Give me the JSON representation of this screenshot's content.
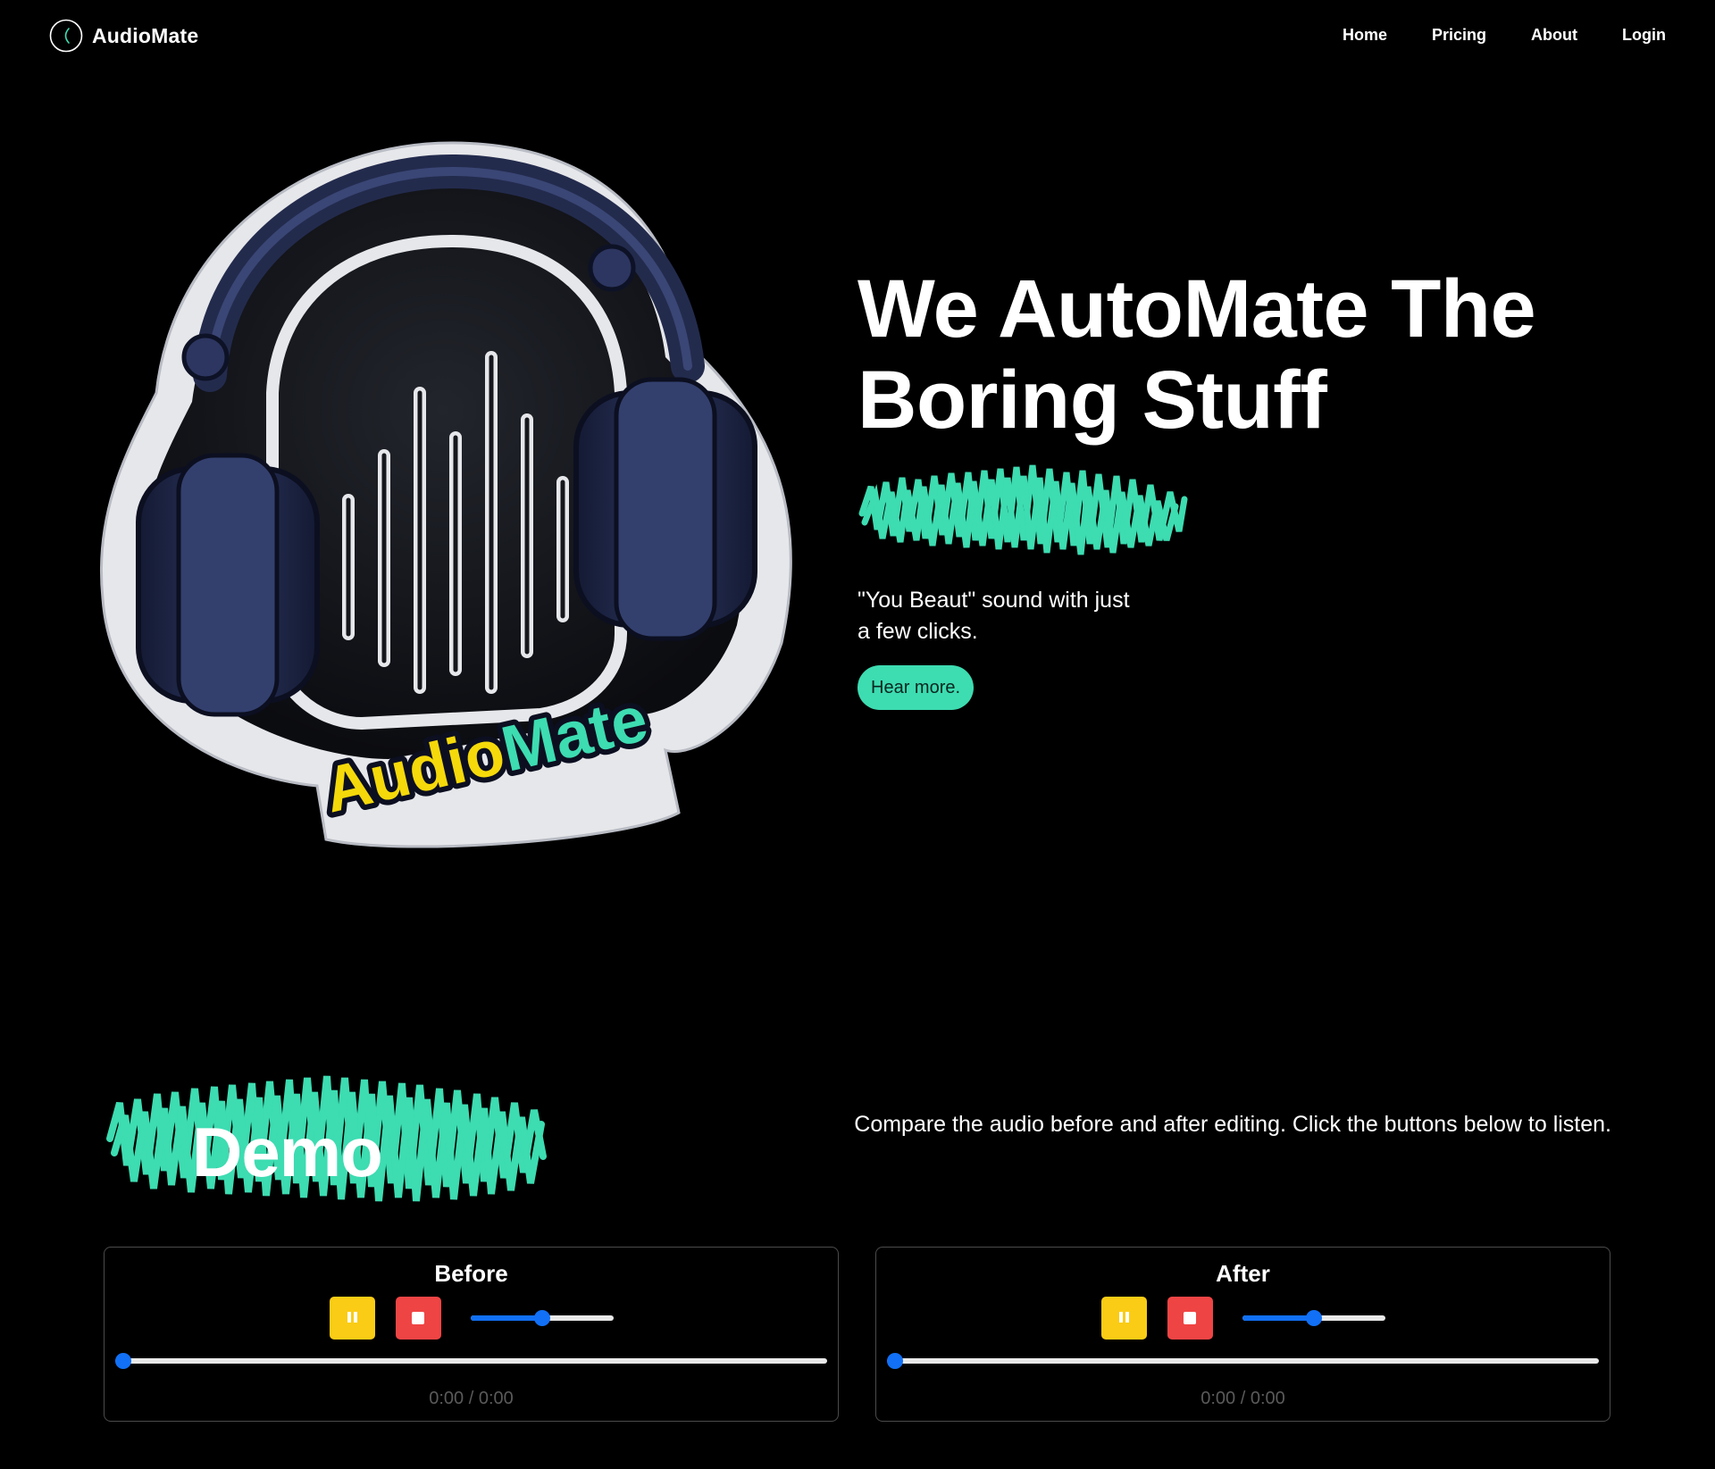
{
  "nav": {
    "brand": "AudioMate",
    "links": [
      "Home",
      "Pricing",
      "About",
      "Login"
    ]
  },
  "hero": {
    "title_line1": "We AutoMate The",
    "title_line2": "Boring Stuff",
    "subtitle": "\"You Beaut\" sound with just a few clicks.",
    "cta": "Hear more.",
    "logo_text_part1": "Audio",
    "logo_text_part2": "Mate"
  },
  "demo": {
    "title": "Demo",
    "description": "Compare the audio before and after editing. Click the buttons below to listen.",
    "players": [
      {
        "label": "Before",
        "time": "0:00 / 0:00",
        "volume": 0.5,
        "progress": 0
      },
      {
        "label": "After",
        "time": "0:00 / 0:00",
        "volume": 0.5,
        "progress": 0
      }
    ]
  },
  "colors": {
    "accent": "#3ddcb1",
    "pause": "#facc15",
    "stop": "#ef4444",
    "slider": "#1170f5",
    "logo_yellow": "#f5d90a",
    "logo_green": "#3ddcb1"
  },
  "icons": [
    "logo-icon",
    "sound-wave-icon",
    "headphones-logo",
    "pause-icon",
    "stop-icon"
  ]
}
